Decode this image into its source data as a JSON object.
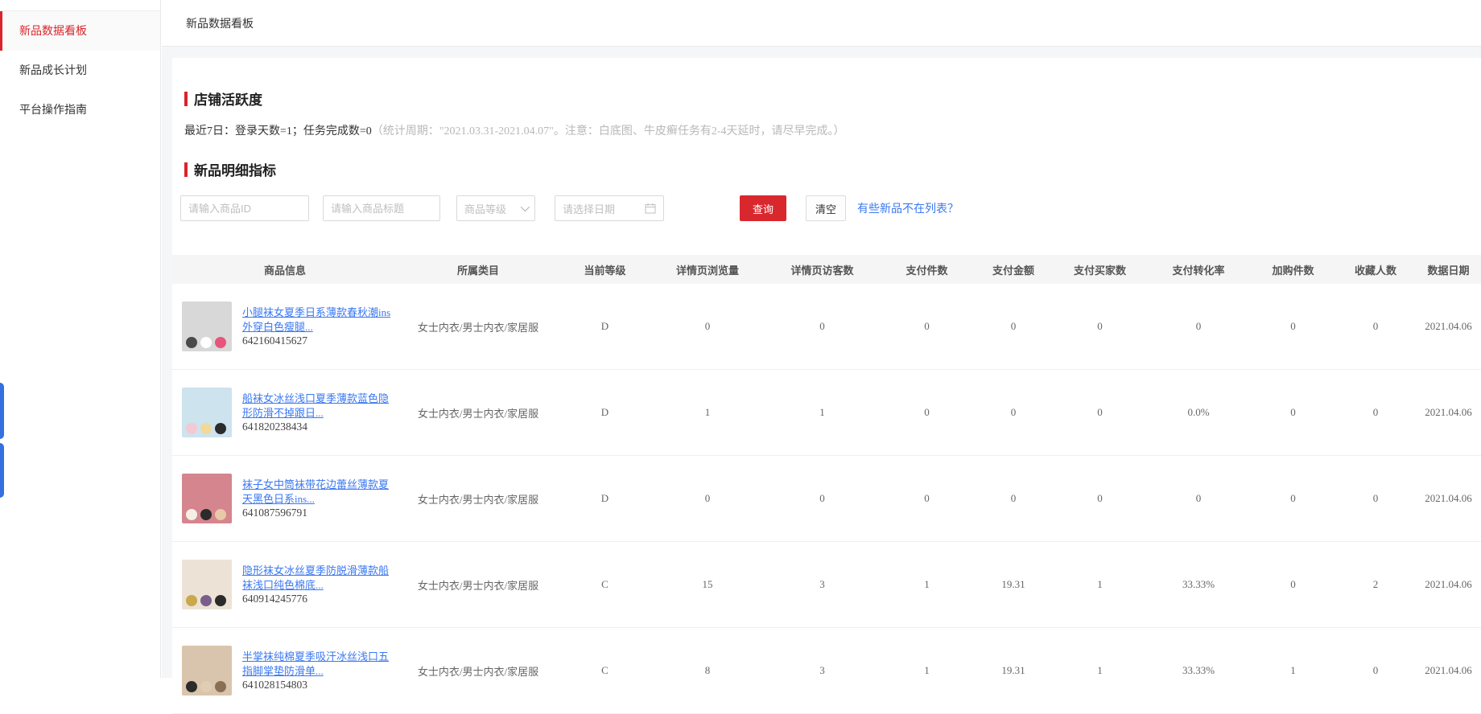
{
  "colors": {
    "accent_red": "#d9252b",
    "button_red": "#d9272e",
    "link_blue": "#3a78f2",
    "edge_pill_blue": "#3370e0",
    "table_header_bg": "#f5f5f5"
  },
  "sidebar": {
    "items": [
      {
        "label": "新品数据看板",
        "active": true
      },
      {
        "label": "新品成长计划",
        "active": false
      },
      {
        "label": "平台操作指南",
        "active": false
      }
    ]
  },
  "header": {
    "breadcrumb": "新品数据看板"
  },
  "activity": {
    "title": "店铺活跃度",
    "summary_dark": "最近7日：登录天数=1；任务完成数=0",
    "summary_gray": "（统计周期：\"2021.03.31-2021.04.07\"。注意：白底图、牛皮癣任务有2-4天延时，请尽早完成。）"
  },
  "metrics": {
    "title": "新品明细指标",
    "filters": {
      "product_id_placeholder": "请输入商品ID",
      "title_placeholder": "请输入商品标题",
      "grade_select_label": "商品等级",
      "date_placeholder": "请选择日期",
      "search_button": "查询",
      "clear_button": "清空",
      "missing_link": "有些新品不在列表？"
    },
    "table": {
      "columns": [
        "商品信息",
        "所属类目",
        "当前等级",
        "详情页浏览量",
        "详情页访客数",
        "支付件数",
        "支付金额",
        "支付买家数",
        "支付转化率",
        "加购件数",
        "收藏人数",
        "数据日期"
      ],
      "rows": [
        {
          "title": "小腿袜女夏季日系薄款春秋潮ins外穿白色瘦腿...",
          "id": "642160415627",
          "category": "女士内衣/男士内衣/家居服",
          "grade": "D",
          "views": "0",
          "visitors": "0",
          "pay_items": "0",
          "pay_amount": "0",
          "pay_buyers": "0",
          "conversion": "0",
          "cart_items": "0",
          "favorites": "0",
          "date": "2021.04.06",
          "thumb": {
            "base": "#d8d8d8",
            "accents": [
              "#4a4a4a",
              "#ffffff",
              "#e8557a"
            ]
          }
        },
        {
          "title": "船袜女冰丝浅口夏季薄款蓝色隐形防滑不掉跟日...",
          "id": "641820238434",
          "category": "女士内衣/男士内衣/家居服",
          "grade": "D",
          "views": "1",
          "visitors": "1",
          "pay_items": "0",
          "pay_amount": "0",
          "pay_buyers": "0",
          "conversion": "0.0%",
          "cart_items": "0",
          "favorites": "0",
          "date": "2021.04.06",
          "thumb": {
            "base": "#cde3ee",
            "accents": [
              "#f3c9d3",
              "#f0d99b",
              "#2b2b2b"
            ]
          }
        },
        {
          "title": "袜子女中筒袜带花边蕾丝薄款夏天黑色日系ins...",
          "id": "641087596791",
          "category": "女士内衣/男士内衣/家居服",
          "grade": "D",
          "views": "0",
          "visitors": "0",
          "pay_items": "0",
          "pay_amount": "0",
          "pay_buyers": "0",
          "conversion": "0",
          "cart_items": "0",
          "favorites": "0",
          "date": "2021.04.06",
          "thumb": {
            "base": "#d4858e",
            "accents": [
              "#f5efe6",
              "#2b2b2b",
              "#e8c9a8"
            ]
          }
        },
        {
          "title": "隐形袜女冰丝夏季防脱滑薄款船袜浅口纯色棉底...",
          "id": "640914245776",
          "category": "女士内衣/男士内衣/家居服",
          "grade": "C",
          "views": "15",
          "visitors": "3",
          "pay_items": "1",
          "pay_amount": "19.31",
          "pay_buyers": "1",
          "conversion": "33.33%",
          "cart_items": "0",
          "favorites": "2",
          "date": "2021.04.06",
          "thumb": {
            "base": "#ece3d6",
            "accents": [
              "#caa84c",
              "#7a5f8a",
              "#2b2b2b"
            ]
          }
        },
        {
          "title": "半掌袜纯棉夏季吸汗冰丝浅口五指脚掌垫防滑单...",
          "id": "641028154803",
          "category": "女士内衣/男士内衣/家居服",
          "grade": "C",
          "views": "8",
          "visitors": "3",
          "pay_items": "1",
          "pay_amount": "19.31",
          "pay_buyers": "1",
          "conversion": "33.33%",
          "cart_items": "1",
          "favorites": "0",
          "date": "2021.04.06",
          "thumb": {
            "base": "#d9c5ad",
            "accents": [
              "#2b2b2b",
              "#e3cdb2",
              "#8a6f52"
            ]
          }
        }
      ]
    }
  }
}
